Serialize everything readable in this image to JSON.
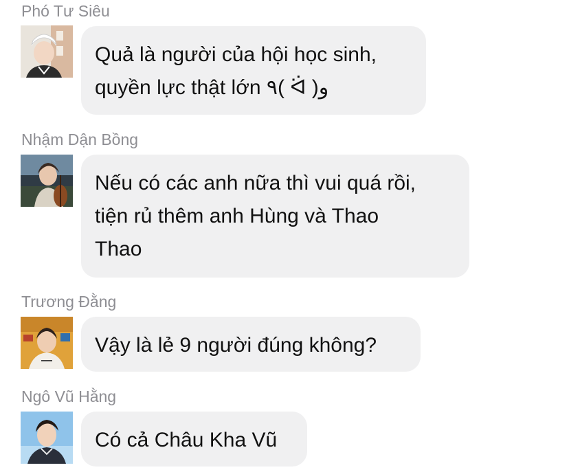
{
  "messages": [
    {
      "sender": "Phó Tư Siêu",
      "lines": [
        "Quả là người của hội học sinh,",
        "quyền lực thật lớn ٩( ᐛ )و"
      ],
      "avatar": "avatar-boy-white-cap"
    },
    {
      "sender": "Nhậm Dận Bồng",
      "lines": [
        "Nếu có các anh nữa thì vui quá rồi,",
        "tiện rủ thêm anh Hùng và Thao",
        "Thao"
      ],
      "avatar": "avatar-boy-cello"
    },
    {
      "sender": "Trương Đằng",
      "lines": [
        "Vậy là lẻ 9 người đúng không?"
      ],
      "avatar": "avatar-boy-yellow-bg"
    },
    {
      "sender": "Ngô Vũ Hằng",
      "lines": [
        "Có cả Châu Kha Vũ"
      ],
      "avatar": "avatar-boy-sky"
    }
  ],
  "colors": {
    "bubble": "#f0f0f1",
    "sender_text": "#8e8e93",
    "message_text": "#111111"
  }
}
